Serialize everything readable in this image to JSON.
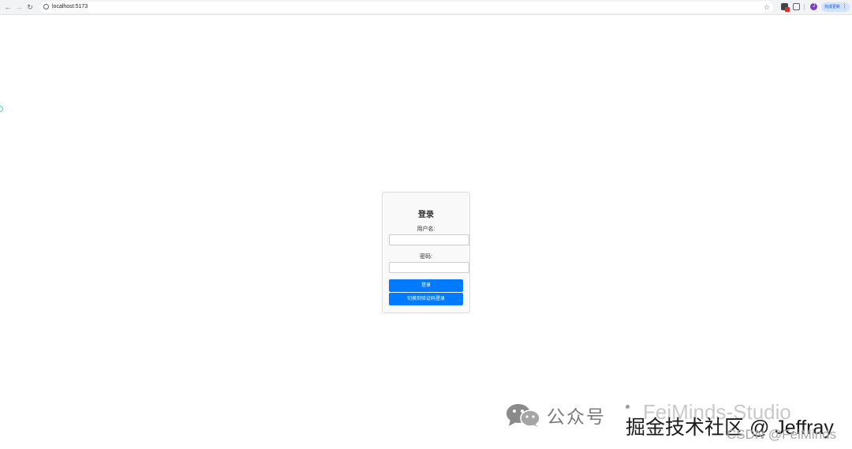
{
  "browser": {
    "back_glyph": "←",
    "forward_glyph": "→",
    "reload_glyph": "↻",
    "url": "localhost:5173",
    "star_glyph": "☆",
    "avatar_letter": "J",
    "update_label": "完成更新",
    "menu_glyph": "⋮",
    "icons": [
      "back-icon",
      "forward-icon",
      "reload-icon",
      "info-icon",
      "star-icon",
      "extension-icon",
      "puzzle-icon",
      "avatar",
      "kebab-menu-icon"
    ]
  },
  "login": {
    "title": "登录",
    "username_label": "用户名:",
    "username_value": "",
    "password_label": "密码:",
    "password_value": "",
    "submit_label": "登录",
    "switch_label": "切换到验证码登录"
  },
  "watermark": {
    "gzh_text": "公众号",
    "studio_text": "FeiMinds-Studio",
    "juejin_text": "掘金技术社区 @ Jeffray",
    "csdn_text": "CSDN @FeiMinds"
  },
  "colors": {
    "primary_button": "#007bff",
    "card_background": "#f9f9f9",
    "chrome_background": "#f1f3f4"
  }
}
